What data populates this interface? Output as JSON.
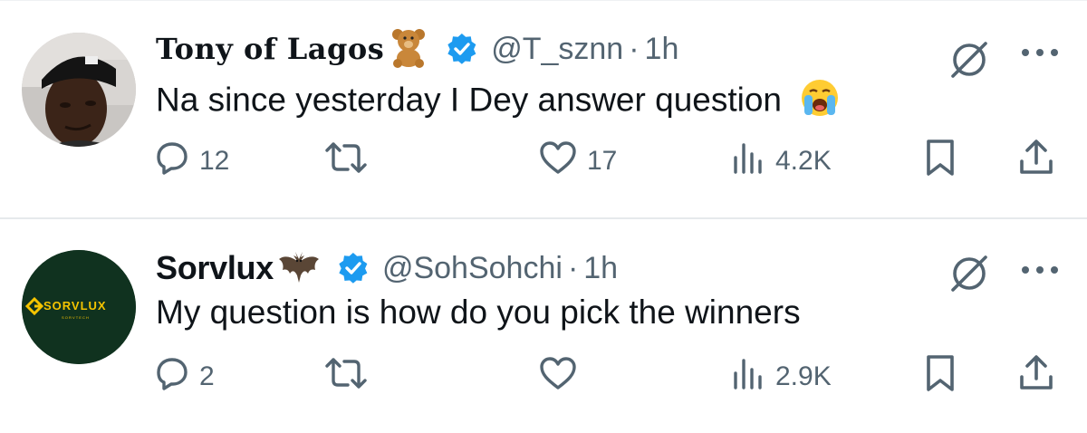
{
  "tweets": [
    {
      "display_name": "Tony of Lagos",
      "name_emoji": "🧸",
      "handle": "@T_sznn",
      "separator": "·",
      "time": "1h",
      "text": "Na since yesterday I Dey answer question",
      "text_emoji": "😭",
      "replies": "12",
      "retweets": "",
      "likes": "17",
      "views": "4.2K"
    },
    {
      "display_name": "Sorvlux",
      "handle": "@SohSohchi",
      "separator": "·",
      "time": "1h",
      "text": "My question is how do you pick the winners",
      "replies": "2",
      "retweets": "",
      "likes": "",
      "views": "2.9K",
      "avatar_logo_text": "SORVLUX",
      "avatar_sub_text": "S O R V T E C H"
    }
  ],
  "colors": {
    "text": "#0f1419",
    "muted": "#536471",
    "verified": "#1d9bf0",
    "divider": "#e6e9ec",
    "sorvlux_bg": "#10321f",
    "sorvlux_logo": "#f5c400"
  },
  "icons": [
    "reply-icon",
    "retweet-icon",
    "like-icon",
    "views-icon",
    "bookmark-icon",
    "share-icon",
    "verified-badge-icon",
    "grok-slash-icon",
    "more-icon",
    "teddy-bear-emoji",
    "crying-face-emoji",
    "bat-emoji"
  ]
}
